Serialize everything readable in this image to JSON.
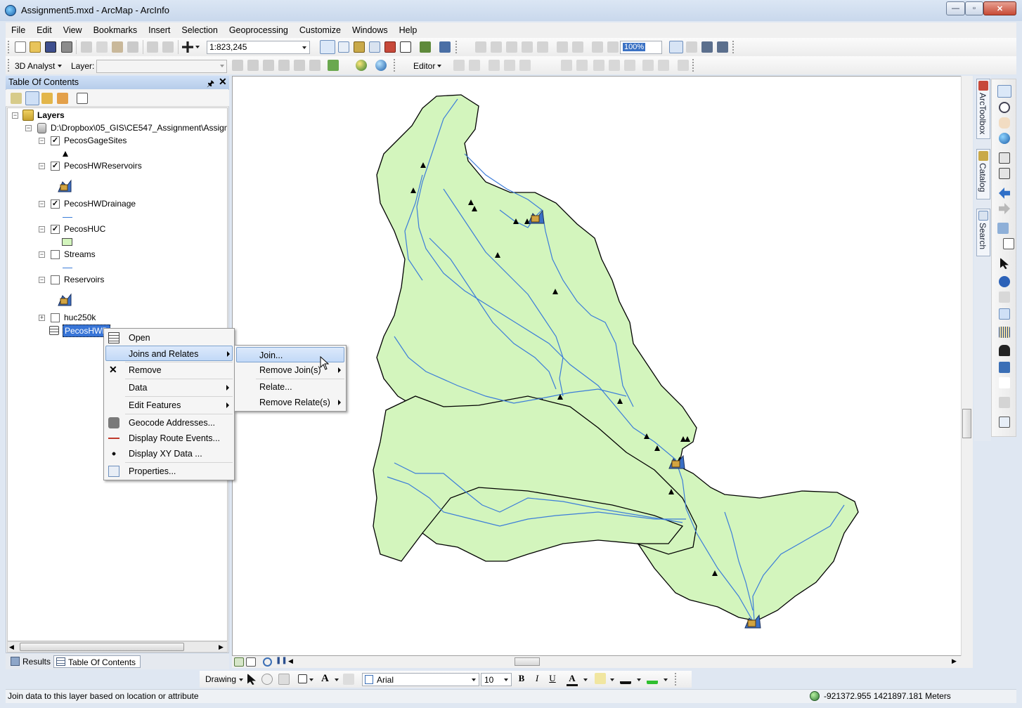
{
  "window": {
    "title": "Assignment5.mxd - ArcMap - ArcInfo",
    "minimize_glyph": "—",
    "maximize_glyph": "▫",
    "close_glyph": "✕"
  },
  "menubar": {
    "items": [
      "File",
      "Edit",
      "View",
      "Bookmarks",
      "Insert",
      "Selection",
      "Geoprocessing",
      "Customize",
      "Windows",
      "Help"
    ]
  },
  "toolbar": {
    "scale_value": "1:823,245",
    "zoom_value": "100%",
    "analyst_label": "3D Analyst",
    "layer_label": "Layer:",
    "layer_value": "",
    "editor_label": "Editor"
  },
  "toc": {
    "title": "Table Of Contents",
    "pin_glyph": "🖈",
    "close_glyph": "✕",
    "root_label": "Layers",
    "data_frame_label": "D:\\Dropbox\\05_GIS\\CE547_Assignment\\Assignr",
    "layers": [
      {
        "name": "PecosGageSites",
        "checked": true,
        "expanded": true,
        "symbol": "triangle"
      },
      {
        "name": "PecosHWReservoirs",
        "checked": true,
        "expanded": true,
        "symbol": "dam"
      },
      {
        "name": "PecosHWDrainage",
        "checked": true,
        "expanded": true,
        "symbol": "line"
      },
      {
        "name": "PecosHUC",
        "checked": true,
        "expanded": true,
        "symbol": "polygon"
      },
      {
        "name": "Streams",
        "checked": false,
        "expanded": true,
        "symbol": "line"
      },
      {
        "name": "Reservoirs",
        "checked": false,
        "expanded": true,
        "symbol": "dam"
      },
      {
        "name": "huc250k",
        "checked": false,
        "expanded": false,
        "symbol": "none"
      }
    ],
    "selected_table_label": "PecosHWD",
    "check_glyph": "✓",
    "tabs": {
      "results": "Results",
      "toc": "Table Of Contents"
    }
  },
  "context_menu": {
    "items": [
      {
        "label": "Open",
        "icon": "table-icon",
        "submenu": false
      },
      {
        "label": "Joins and Relates",
        "icon": "none",
        "submenu": true,
        "highlighted": true
      },
      {
        "label": "Remove",
        "icon": "x-icon",
        "submenu": false
      },
      {
        "label": "Data",
        "icon": "none",
        "submenu": true
      },
      {
        "label": "Edit Features",
        "icon": "none",
        "submenu": true
      },
      {
        "label": "Geocode Addresses...",
        "icon": "geocode-icon",
        "submenu": false
      },
      {
        "label": "Display Route Events...",
        "icon": "route-events-icon",
        "submenu": false
      },
      {
        "label": "Display XY Data ...",
        "icon": "xy-data-icon",
        "submenu": false
      },
      {
        "label": "Properties...",
        "icon": "properties-icon",
        "submenu": false
      }
    ],
    "remove_glyph": "✕"
  },
  "submenu": {
    "items": [
      {
        "label": "Join...",
        "submenu": false,
        "highlighted": true
      },
      {
        "label": "Remove Join(s)",
        "submenu": true
      },
      {
        "label": "Relate...",
        "submenu": false
      },
      {
        "label": "Remove Relate(s)",
        "submenu": true
      }
    ]
  },
  "right_dock": {
    "tabs": [
      "ArcToolbox",
      "Catalog",
      "Search"
    ]
  },
  "drawing_toolbar": {
    "drawing_label": "Drawing",
    "font_name": "Arial",
    "font_size": "10",
    "bold": "B",
    "italic": "I",
    "underline": "U",
    "font_color_glyph": "A",
    "text_tool_glyph": "A"
  },
  "status": {
    "message": "Join data to this layer based on location or attribute",
    "coordinates": "-921372.955  1421897.181 Meters"
  },
  "colors": {
    "watershed_fill": "#d3f5bd",
    "stream_blue": "#3c7dd9",
    "highlight": "#c2d9f7",
    "toc_header": "#b6cdea"
  },
  "map": {
    "gage_count": 20,
    "reservoir_count": 3
  }
}
